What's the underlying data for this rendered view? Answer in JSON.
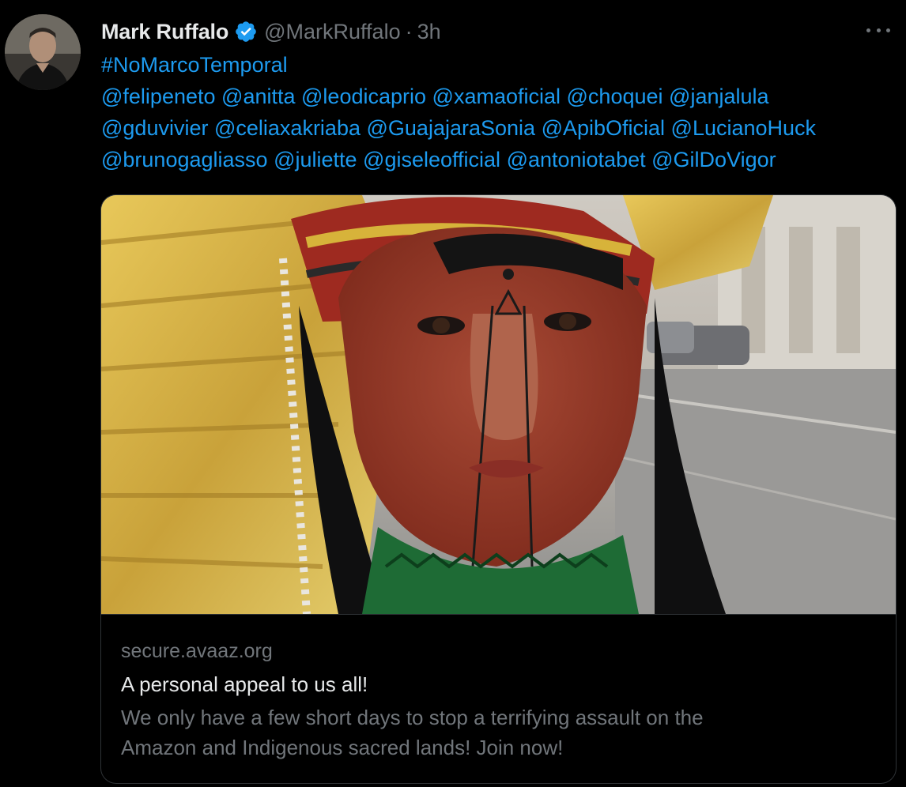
{
  "tweet": {
    "author": {
      "display_name": "Mark Ruffalo",
      "handle": "@MarkRuffalo",
      "separator": "·",
      "time": "3h",
      "verified": true
    },
    "text_lines": [
      [
        "#NoMarcoTemporal"
      ],
      [
        "@felipeneto",
        "@anitta",
        "@leodicaprio",
        "@xamaoficial",
        "@choquei",
        "@janjalula"
      ],
      [
        "@gduvivier",
        "@celiaxakriaba",
        "@GuajajaraSonia",
        "@ApibOficial",
        "@LucianoHuck"
      ],
      [
        "@brunogagliasso",
        "@juliette",
        "@giseleofficial",
        "@antoniotabet",
        "@GilDoVigor"
      ]
    ],
    "card": {
      "domain": "secure.avaaz.org",
      "title": "A personal appeal to us all!",
      "description_lines": [
        "We only have a few short days to stop a terrifying assault on the",
        "Amazon and Indigenous sacred lands! Join now!"
      ]
    }
  },
  "icons": {
    "verified": "verified-badge-icon",
    "more": "more-horizontal-icon"
  },
  "colors": {
    "background": "#000000",
    "text_primary": "#e7e9ea",
    "text_secondary": "#71767b",
    "link": "#1d9bf0",
    "border": "#2f3336"
  }
}
